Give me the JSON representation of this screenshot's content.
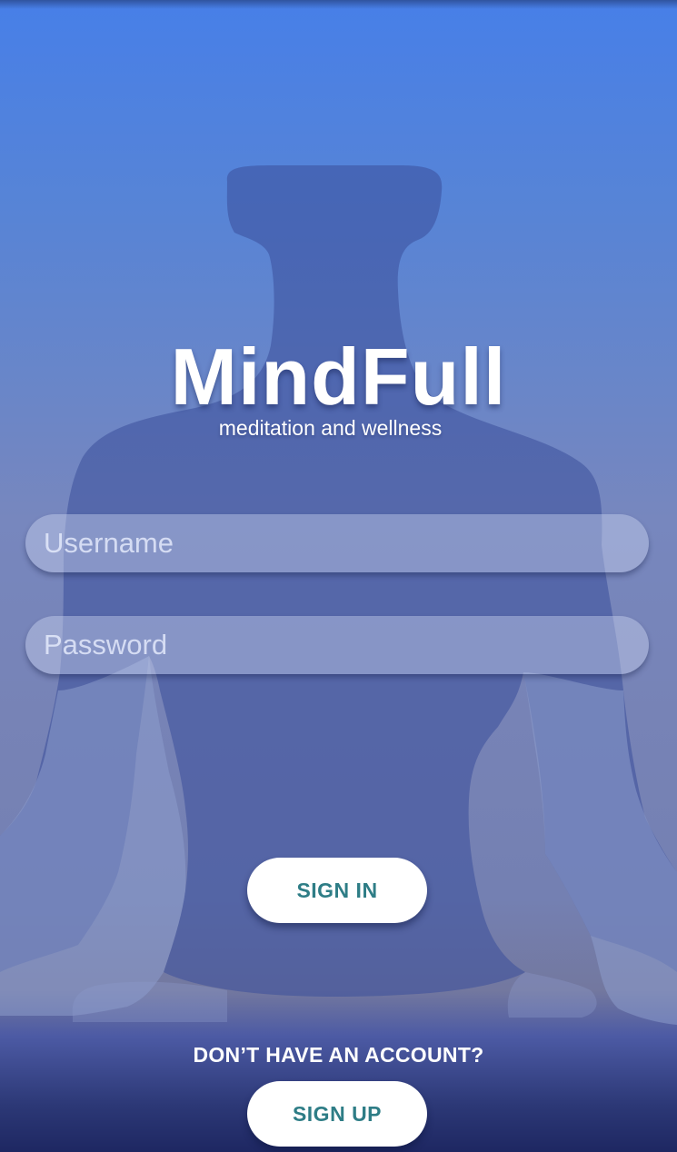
{
  "app": {
    "title": "MindFull",
    "subtitle": "meditation and wellness"
  },
  "form": {
    "username": {
      "placeholder": "Username",
      "value": ""
    },
    "password": {
      "placeholder": "Password",
      "value": ""
    }
  },
  "actions": {
    "sign_in_label": "SIGN IN",
    "no_account_text": "DON’T HAVE AN ACCOUNT?",
    "sign_up_label": "SIGN UP"
  },
  "colors": {
    "gradient_top": "#477fe8",
    "gradient_bottom": "#1e2762",
    "button_background": "#ffffff",
    "button_text": "#2e7d86"
  },
  "background": {
    "icon": "meditation-silhouette-icon"
  }
}
